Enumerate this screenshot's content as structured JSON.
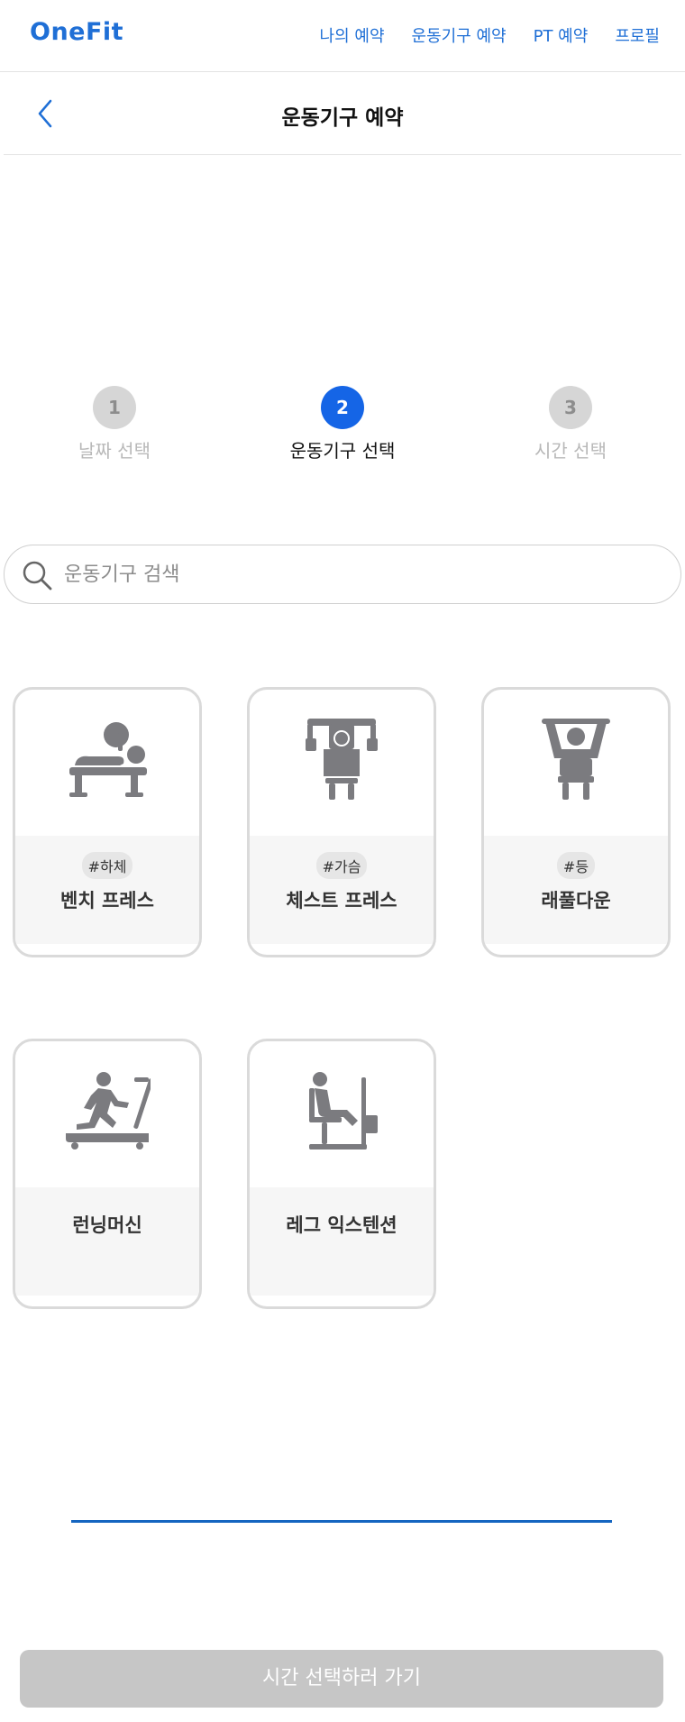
{
  "brand": "OneFit",
  "nav": [
    "나의 예약",
    "운동기구 예약",
    "PT 예약",
    "프로필"
  ],
  "header": {
    "title": "운동기구 예약"
  },
  "steps": [
    {
      "number": "1",
      "label": "날짜 선택",
      "state": "done"
    },
    {
      "number": "2",
      "label": "운동기구 선택",
      "state": "active"
    },
    {
      "number": "3",
      "label": "시간 선택",
      "state": "pending"
    }
  ],
  "search": {
    "placeholder": "운동기구 검색",
    "value": ""
  },
  "equipment": [
    {
      "tag": "#하체",
      "name": "벤치 프레스",
      "icon": "bench-press-icon"
    },
    {
      "tag": "#가슴",
      "name": "체스트 프레스",
      "icon": "chest-press-icon"
    },
    {
      "tag": "#등",
      "name": "래풀다운",
      "icon": "lat-pulldown-icon"
    },
    {
      "tag": "",
      "name": "런닝머신",
      "icon": "treadmill-icon"
    },
    {
      "tag": "",
      "name": "레그 익스텐션",
      "icon": "leg-extension-icon"
    }
  ],
  "cta": {
    "label": "시간 선택하러 가기",
    "enabled": false
  },
  "colors": {
    "accent": "#1f6fd6",
    "step_active": "#1565e6",
    "card_border": "#dadada",
    "disabled": "#c6c6c6"
  }
}
